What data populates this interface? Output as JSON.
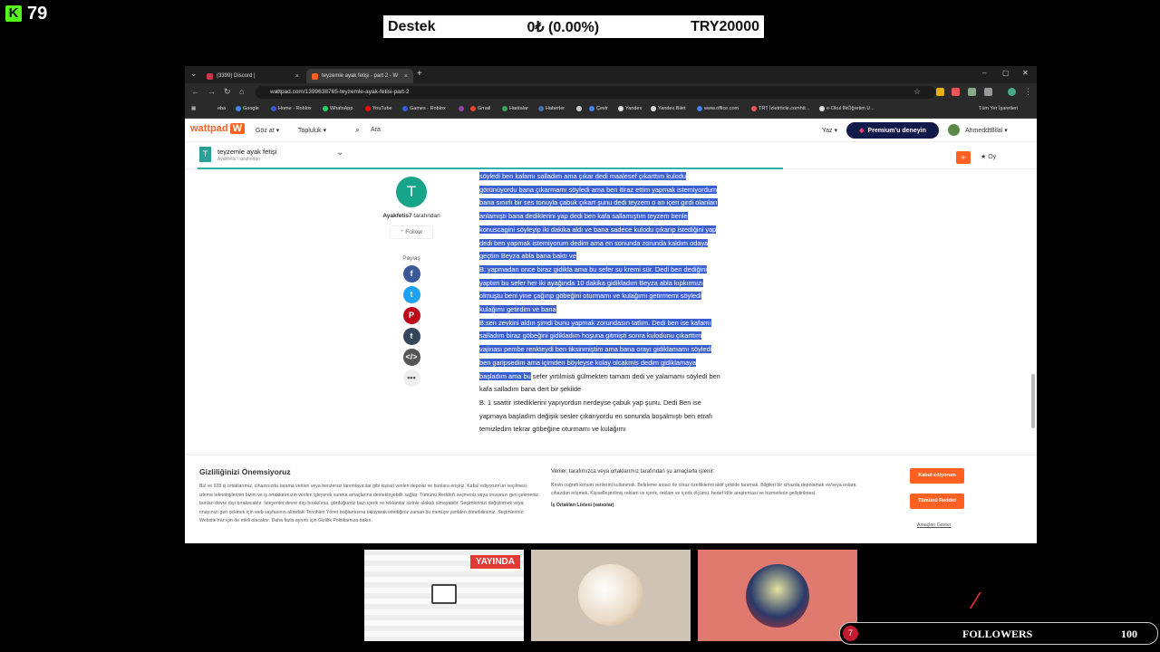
{
  "overlay": {
    "viewer_count": "79",
    "goal": {
      "label": "Destek",
      "value": "0₺ (0.00%)",
      "target": "TRY20000"
    },
    "live_badge": "YAYINDA",
    "followers": {
      "current": "7",
      "label": "FOLLOWERS",
      "goal": "100"
    }
  },
  "browser": {
    "tabs": [
      {
        "label": "(3399) Discord | ",
        "active": false
      },
      {
        "label": "teyzemle ayak fetişi - part 2 - W",
        "active": true
      }
    ],
    "url": "wattpad.com/1399638765-teyzemle-ayak-fetisi-part-2",
    "bookmarks": [
      "eba",
      "Google",
      "Home - Roblox",
      "WhatsApp",
      "YouTube",
      "Games - Roblox",
      "Gmail",
      "Haritalar",
      "Haberler",
      "Çevir",
      "Yandex",
      "Yandex.Bilet",
      "www.office.com",
      "TRT İzletrticle.comhtt...",
      "e-Okul İlkÖğretim U...",
      "Tüm Yer İşaretleri"
    ]
  },
  "wattpad": {
    "logo": "wattpad",
    "nav": {
      "browse": "Göz at ▾",
      "community": "Topluluk ▾",
      "search": "Ara"
    },
    "write": "Yaz ▾",
    "premium": "Premium'u deneyin",
    "username": "AhmeddtBilal ▾",
    "story": {
      "icon": "T",
      "title": "teyzemle ayak fetişi",
      "author_line": "Ayakfetis / tarafından"
    },
    "vote": "Oy",
    "author": {
      "avatar": "T",
      "name": "Ayakfetis7",
      "suffix": "tarafından",
      "follow": "Follow"
    },
    "share_label": "Paylaş",
    "paragraphs": [
      {
        "h": true,
        "text": "söyledi ben kafamı salladım ama çıkar dedi maalesef çıkarttım kulodu görünüyordu bana çıkarmamı söyledi ama ben itiraz ettim yapmak istemiyordum bana sınırlı bir ses tonuyla çabuk çıkart şunu dedi teyzem o an içeri girdi olanları anlamıştı bana dediklerini yap dedi ben kafa sallamıştım teyzem benle konuscagini söyleyip iki dakika aldı ve bana sadece kulodu çıkarıp istediğini yap dedi ben yapmak istemiyorum dedim ama en sonunda zorunda kaldım odaya geçtim Beyza abla bana baktı ve"
      },
      {
        "h": true,
        "text": "B: yapmadan once biraz gidikla ama bu sefer su kremi sür. Dedi ben dediğini yaptım bu sefer her iki ayağında 10 dakika gidikladım Beyza abla kıpkırmızı olmuştu beni yine çağırıp göbeğini oturmamı ve kulağımı getirmemi söyledi kulağımı getirdim ve bana"
      },
      {
        "h": "partial",
        "text": "B:sen zevkini aldın şimdi bunu yapmak zorundasın tatlım. Dedi ben ise kafamı salladım biraz göbeğini gidikladım hoşuna gitmişti sonra kulodunu çıkarttım vajinası pembe renkteydi ben tiksinmiştim ama bana orayı gidiklamamı söyledi ben garipsedim ama içimden böyleyse kolay olcakmis dedim gidiklamaya başladım ama bu",
        "rest": " sefer yirtilmisti gülmekten tamam dedi ve yalamamı söyledi ben kafa salladım bana dert bir şekilde"
      },
      {
        "h": false,
        "text": "B: 1 saattir istediklerini yapıyordun nerdeyse çabuk yap şunu. Dedi Ben ise yapmaya başladım değişik sesler çıkarıyordu en sonunda boşalmıştı ben etrafı temizledim tekrar göbeğine oturmamı ve kulağımı"
      }
    ]
  },
  "consent": {
    "title": "Gizliliğinizi Önemsiyoruz",
    "body": "Biz ve 928 iş ortaklarımız, cihazınızda tarama verileri veya benzersiz tanımlayıcılar gibi kişisel verileri depolar ve bunlara erişiriz. Kabul ediyorum'un seçilmesi, izleme teknolojilerinin bizim ve iş ortaklarımızın verileri işleyerek sunma amaçlarına destekleyebilir sağlar. Tümünü Reddet'i seçmeniz veya onayınızı geri çekmeniz bunları devre dışı bırakacaktır. İsteyenler devre dışı bırakılırsa, gördüğünüz bazı içerik ve reklamlar sizinle alakalı olmayabilir. Seçimlerinizi değiştirmek veya onayınızı geri çekmek için web sayfasının altındaki Tercihleri Yönet bağlantısına tıklayarak istediğiniz zaman bu menüye yeniden dönebilirsiniz. Seçimleriniz Website'miz için de etkili olacaktır. Daha fazla ayrıntı için Gizlilik Politikamıza bakın.",
    "partners_title": "Veriler, tarafımızca veya ortaklarımız tarafından şu amaçlarla işlenir:",
    "partners_body": "Kesin coğrafi konum verilerini kullanmak. Belirleme amacı ile cihaz özelliklerini aktif şekilde taramak. Bilgileri bir cihazda depolamak ve/veya onlara cihazdan erişmek. Kişiselleştirilmiş reklam ve içerik, reklam ve içerik ölçümü, hedef kitle araştırması ve hizmetlerin geliştirilmesi.",
    "partners_link": "İş Ortakları Listesi (satıcılar)",
    "accept": "Kabul ediyorum",
    "reject": "Tümünü Reddet",
    "purposes": "Amaçları Göster"
  }
}
